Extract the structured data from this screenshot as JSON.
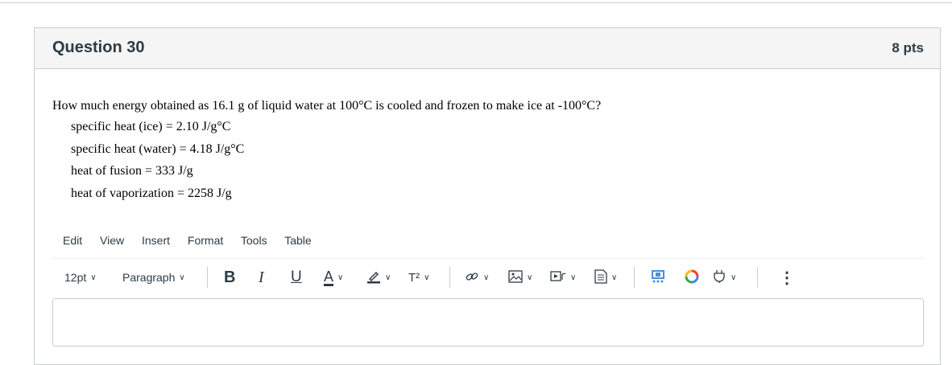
{
  "question": {
    "title": "Question 30",
    "points": "8 pts",
    "prompt": "How much energy obtained as 16.1 g of liquid water at 100°C is cooled and frozen to make ice at -100°C?",
    "data_lines": [
      "specific heat (ice) = 2.10 J/g°C",
      "specific heat (water) = 4.18 J/g°C",
      "heat of fusion = 333 J/g",
      "heat of vaporization = 2258 J/g"
    ]
  },
  "editor": {
    "menu": [
      "Edit",
      "View",
      "Insert",
      "Format",
      "Tools",
      "Table"
    ],
    "toolbar": {
      "font_size": "12pt",
      "block_format": "Paragraph",
      "superscript_label": "T²",
      "more_label": "⋮"
    },
    "colors": {
      "border": "#c7cdd1",
      "header_bg": "#f5f5f5",
      "text": "#2d3b45"
    },
    "icons": [
      "bold-icon",
      "italic-icon",
      "underline-icon",
      "text-color-icon",
      "highlight-icon",
      "superscript-icon",
      "link-icon",
      "image-icon",
      "media-icon",
      "document-icon",
      "apps-icon",
      "google-drive-icon",
      "plugin-icon",
      "more-icon"
    ]
  }
}
